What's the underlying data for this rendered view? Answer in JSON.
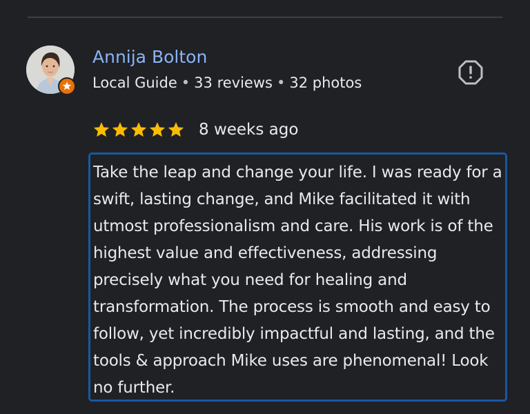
{
  "reviewer": {
    "name": "Annija Bolton",
    "badge": "Local Guide",
    "reviews": "33 reviews",
    "photos": "32 photos",
    "separator": "•"
  },
  "review": {
    "rating": 5,
    "max_rating": 5,
    "time": "8 weeks ago",
    "text": "Take the leap and change your life. I was ready for a swift, lasting change, and Mike facilitated it with utmost professionalism and care. His work is of the highest value and effectiveness, addressing precisely what you need for healing and transformation. The process is smooth and easy to follow, yet incredibly impactful and lasting, and the tools & approach Mike uses are phenomenal! Look no further."
  },
  "icons": {
    "avatar": "avatar-photo",
    "badge": "local-guide-star-badge",
    "report": "report-flag-icon",
    "star": "star-icon"
  },
  "colors": {
    "background": "#202124",
    "name": "#8ab4f8",
    "text": "#e8eaed",
    "star": "#fbbc04",
    "badge": "#e8710a",
    "highlight_border": "#1a57a3"
  }
}
